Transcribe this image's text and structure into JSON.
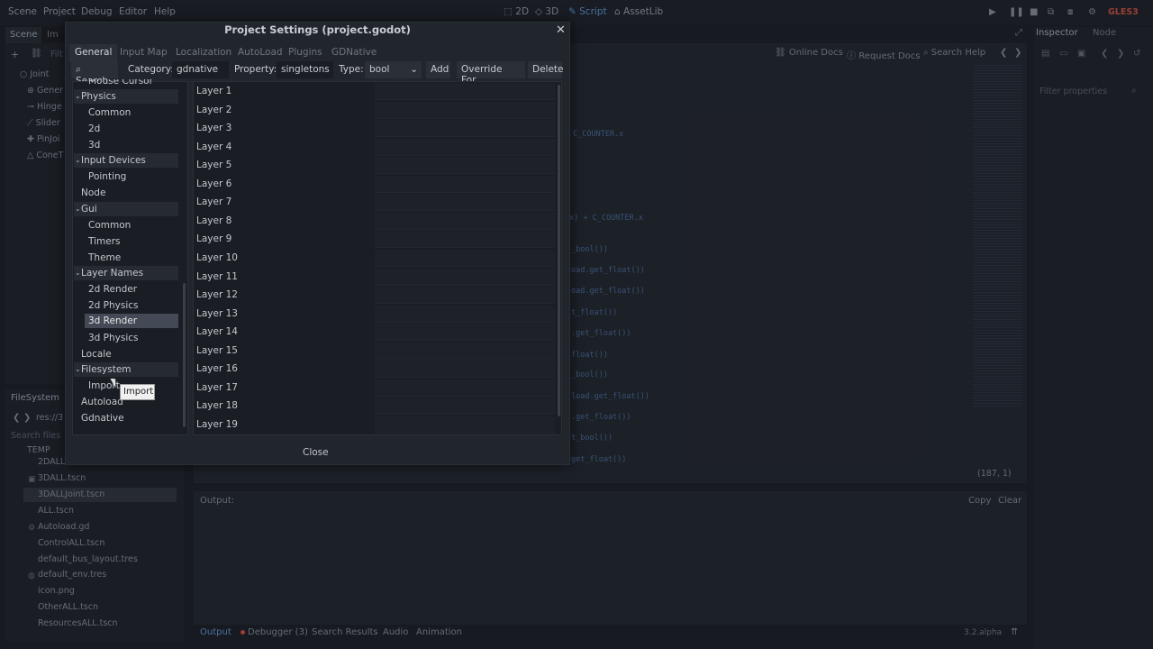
{
  "menubar": {
    "items": [
      "Scene",
      "Project",
      "Debug",
      "Editor",
      "Help"
    ],
    "workspaces": [
      "2D",
      "3D",
      "Script",
      "AssetLib"
    ],
    "active_workspace": "Script",
    "renderer": "GLES3"
  },
  "scene_dock": {
    "tab": "Scene",
    "tab2": "Im",
    "filter": "Filt",
    "nodes": [
      "Joint",
      "Gener",
      "Hinge",
      "Slider",
      "PinJoi",
      "ConeT"
    ]
  },
  "filesystem": {
    "title": "FileSystem",
    "path": "res://3",
    "search": "Search files",
    "files": [
      "TEMP",
      "2DALL",
      "3DALL.tscn",
      "3DALLJoint.tscn",
      "ALL.tscn",
      "Autoload.gd",
      "ControlALL.tscn",
      "default_bus_layout.tres",
      "default_env.tres",
      "icon.png",
      "OtherALL.tscn",
      "ResourcesALL.tscn"
    ]
  },
  "script_area": {
    "links": [
      "Online Docs",
      "Request Docs",
      "Search Help"
    ],
    "code_lines": [
      "C_COUNTER.x",
      "x) + C_COUNTER.x",
      "_bool())",
      "oad.get_float())",
      "oad.get_float())",
      "t_float())",
      ".get_float())",
      "float())",
      "_bool())",
      "load.get_float())",
      ".get_float())",
      "t_bool())",
      "get_float())"
    ],
    "cursor_pos": "(187,    1)"
  },
  "output": {
    "label": "Output:",
    "copy": "Copy",
    "clear": "Clear",
    "tabs": [
      "Output",
      "Debugger (3)",
      "Search Results",
      "Audio",
      "Animation"
    ],
    "version": "3.2.alpha"
  },
  "inspector": {
    "tab": "Inspector",
    "tab2": "Node",
    "filter": "Filter properties"
  },
  "dialog": {
    "title": "Project Settings (project.godot)",
    "close_x": "✕",
    "tabs": [
      "General",
      "Input Map",
      "Localization",
      "AutoLoad",
      "Plugins",
      "GDNative"
    ],
    "toolbar": {
      "search": "Search",
      "category_label": "Category:",
      "category_value": "gdnative",
      "property_label": "Property:",
      "property_value": "singletons",
      "type_label": "Type:",
      "type_value": "bool",
      "add": "Add",
      "override": "Override For...",
      "delete": "Delete"
    },
    "tree_partial": "Mouse Cursor",
    "tree": {
      "physics": "Physics",
      "physics_items": [
        "Common",
        "2d",
        "3d"
      ],
      "input_devices": "Input Devices",
      "input_items": [
        "Pointing"
      ],
      "node": "Node",
      "gui": "Gui",
      "gui_items": [
        "Common",
        "Timers",
        "Theme"
      ],
      "layer_names": "Layer Names",
      "layer_items": [
        "2d Render",
        "2d Physics",
        "3d Render",
        "3d Physics"
      ],
      "locale": "Locale",
      "filesystem": "Filesystem",
      "filesystem_items": [
        "Import"
      ],
      "autoload": "Autoload",
      "gdnative": "Gdnative"
    },
    "layers": [
      "Layer 1",
      "Layer 2",
      "Layer 3",
      "Layer 4",
      "Layer 5",
      "Layer 6",
      "Layer 7",
      "Layer 8",
      "Layer 9",
      "Layer 10",
      "Layer 11",
      "Layer 12",
      "Layer 13",
      "Layer 14",
      "Layer 15",
      "Layer 16",
      "Layer 17",
      "Layer 18",
      "Layer 19"
    ],
    "close_button": "Close",
    "tooltip": "Import"
  }
}
